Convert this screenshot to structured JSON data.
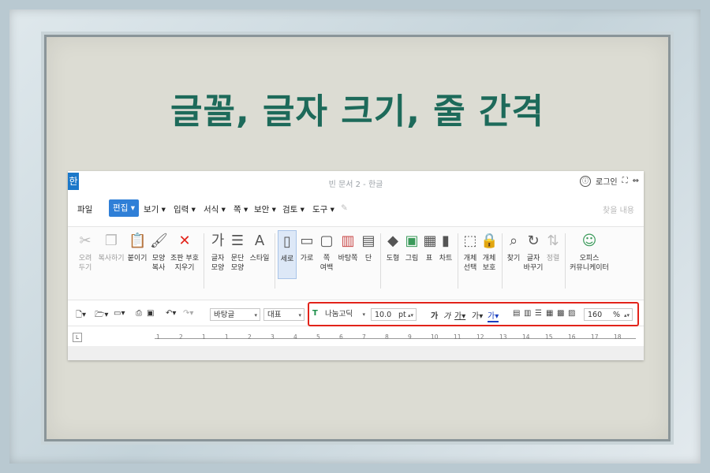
{
  "title": "글꼴, 글자 크기, 줄 간격",
  "window": {
    "app_logo": "한",
    "doc_title": "빈 문서 2 - 한글",
    "login": "로그인"
  },
  "menu": {
    "file": "파일",
    "edit": "편집",
    "items": [
      "보기",
      "입력",
      "서식",
      "쪽",
      "보안",
      "검토",
      "도구"
    ],
    "search_placeholder": "찾을 내용"
  },
  "ribbon": {
    "cut": "오려\n두기",
    "copy": "복사하기",
    "paste": "붙이기",
    "shape_copy": "모양\n복사",
    "clear_format": "조판 부호\n지우기",
    "char_shape": "글자\n모양",
    "para_shape": "문단\n모양",
    "style": "스타일",
    "portrait": "세로",
    "landscape": "가로",
    "margins": "쪽\n여백",
    "page_border": "바탕쪽",
    "columns": "단",
    "shapes": "도형",
    "picture": "그림",
    "table": "표",
    "chart": "차트",
    "select_object": "개체\n선택",
    "protect_object": "개체\n보호",
    "find": "찾기",
    "replace": "글자\n바꾸기",
    "sort": "정렬",
    "office": "오피스\n커뮤니케이터"
  },
  "format": {
    "style": "바탕글",
    "lang": "대표",
    "font": "나눔고딕",
    "size": "10.0",
    "unit": "pt",
    "bold": "가",
    "italic": "가",
    "underline": "가",
    "strike": "가",
    "color": "가",
    "line_spacing": "160",
    "percent": "%"
  },
  "ruler": {
    "ticks": [
      "1",
      "2",
      "1",
      "1",
      "2",
      "3",
      "4",
      "5",
      "6",
      "7",
      "8",
      "9",
      "10",
      "11",
      "12",
      "13",
      "14",
      "15",
      "16",
      "17",
      "18"
    ],
    "corner": "L"
  },
  "colors": {
    "title": "#1d6a5a",
    "accent": "#2f7fd7",
    "highlight": "#e2231a"
  }
}
